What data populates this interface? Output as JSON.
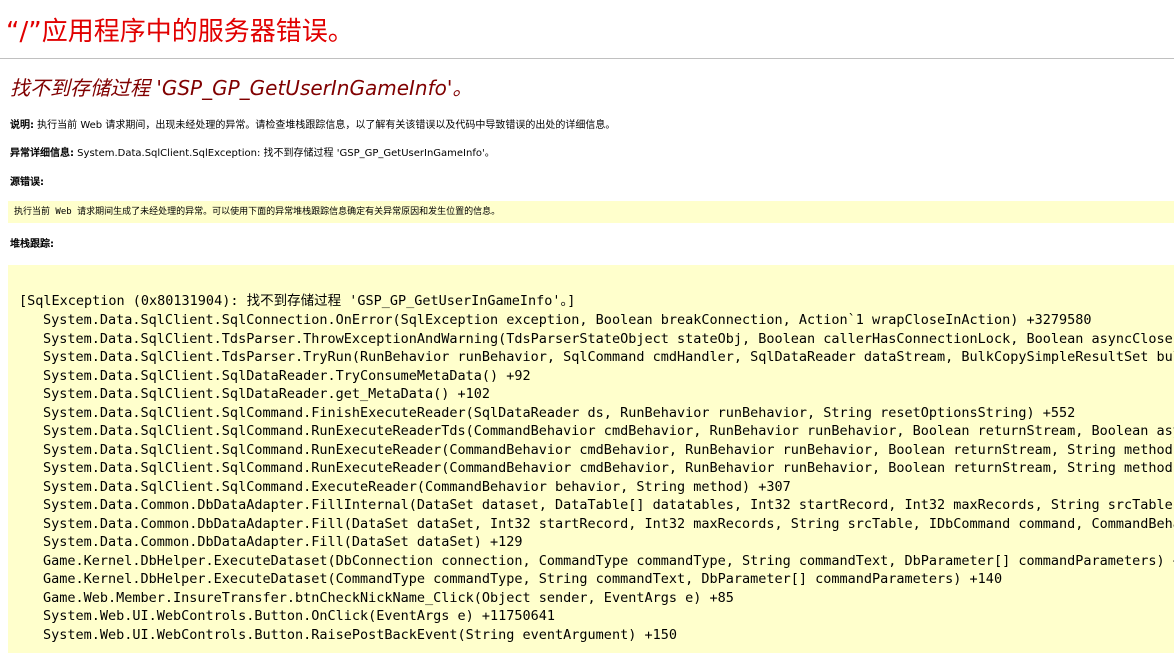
{
  "page": {
    "title": "“/”应用程序中的服务器错误。",
    "error_heading": "找不到存储过程 'GSP_GP_GetUserInGameInfo'。"
  },
  "description": {
    "label": "说明:",
    "text": " 执行当前 Web 请求期间，出现未经处理的异常。请检查堆栈跟踪信息，以了解有关该错误以及代码中导致错误的出处的详细信息。"
  },
  "exception_details": {
    "label": "异常详细信息:",
    "text": " System.Data.SqlClient.SqlException: 找不到存储过程 'GSP_GP_GetUserInGameInfo'。"
  },
  "source_error": {
    "label": "源错误:",
    "text": "执行当前 Web 请求期间生成了未经处理的异常。可以使用下面的异常堆栈跟踪信息确定有关异常原因和发生位置的信息。"
  },
  "stack_trace": {
    "label": "堆栈跟踪:",
    "header": "[SqlException (0x80131904): 找不到存储过程 'GSP_GP_GetUserInGameInfo'。]",
    "frames": [
      "System.Data.SqlClient.SqlConnection.OnError(SqlException exception, Boolean breakConnection, Action`1 wrapCloseInAction) +3279580",
      "System.Data.SqlClient.TdsParser.ThrowExceptionAndWarning(TdsParserStateObject stateObj, Boolean callerHasConnectionLock, Boolean asyncClose) +",
      "System.Data.SqlClient.TdsParser.TryRun(RunBehavior runBehavior, SqlCommand cmdHandler, SqlDataReader dataStream, BulkCopySimpleResultSet bulkCo",
      "System.Data.SqlClient.SqlDataReader.TryConsumeMetaData() +92",
      "System.Data.SqlClient.SqlDataReader.get_MetaData() +102",
      "System.Data.SqlClient.SqlCommand.FinishExecuteReader(SqlDataReader ds, RunBehavior runBehavior, String resetOptionsString) +552",
      "System.Data.SqlClient.SqlCommand.RunExecuteReaderTds(CommandBehavior cmdBehavior, RunBehavior runBehavior, Boolean returnStream, Boolean async",
      "System.Data.SqlClient.SqlCommand.RunExecuteReader(CommandBehavior cmdBehavior, RunBehavior runBehavior, Boolean returnStream, String method, T",
      "System.Data.SqlClient.SqlCommand.RunExecuteReader(CommandBehavior cmdBehavior, RunBehavior runBehavior, Boolean returnStream, String method) +",
      "System.Data.SqlClient.SqlCommand.ExecuteReader(CommandBehavior behavior, String method) +307",
      "System.Data.Common.DbDataAdapter.FillInternal(DataSet dataset, DataTable[] datatables, Int32 startRecord, Int32 maxRecords, String srcTable, I",
      "System.Data.Common.DbDataAdapter.Fill(DataSet dataSet, Int32 startRecord, Int32 maxRecords, String srcTable, IDbCommand command, CommandBehavi",
      "System.Data.Common.DbDataAdapter.Fill(DataSet dataSet) +129",
      "Game.Kernel.DbHelper.ExecuteDataset(DbConnection connection, CommandType commandType, String commandText, DbParameter[] commandParameters) +22",
      "Game.Kernel.DbHelper.ExecuteDataset(CommandType commandType, String commandText, DbParameter[] commandParameters) +140",
      "Game.Web.Member.InsureTransfer.btnCheckNickName_Click(Object sender, EventArgs e) +85",
      "System.Web.UI.WebControls.Button.OnClick(EventArgs e) +11750641",
      "System.Web.UI.WebControls.Button.RaisePostBackEvent(String eventArgument) +150"
    ]
  },
  "colors": {
    "title": "#e10000",
    "heading": "#800000",
    "code_background": "#ffffcc",
    "divider": "#c0c0c0"
  }
}
